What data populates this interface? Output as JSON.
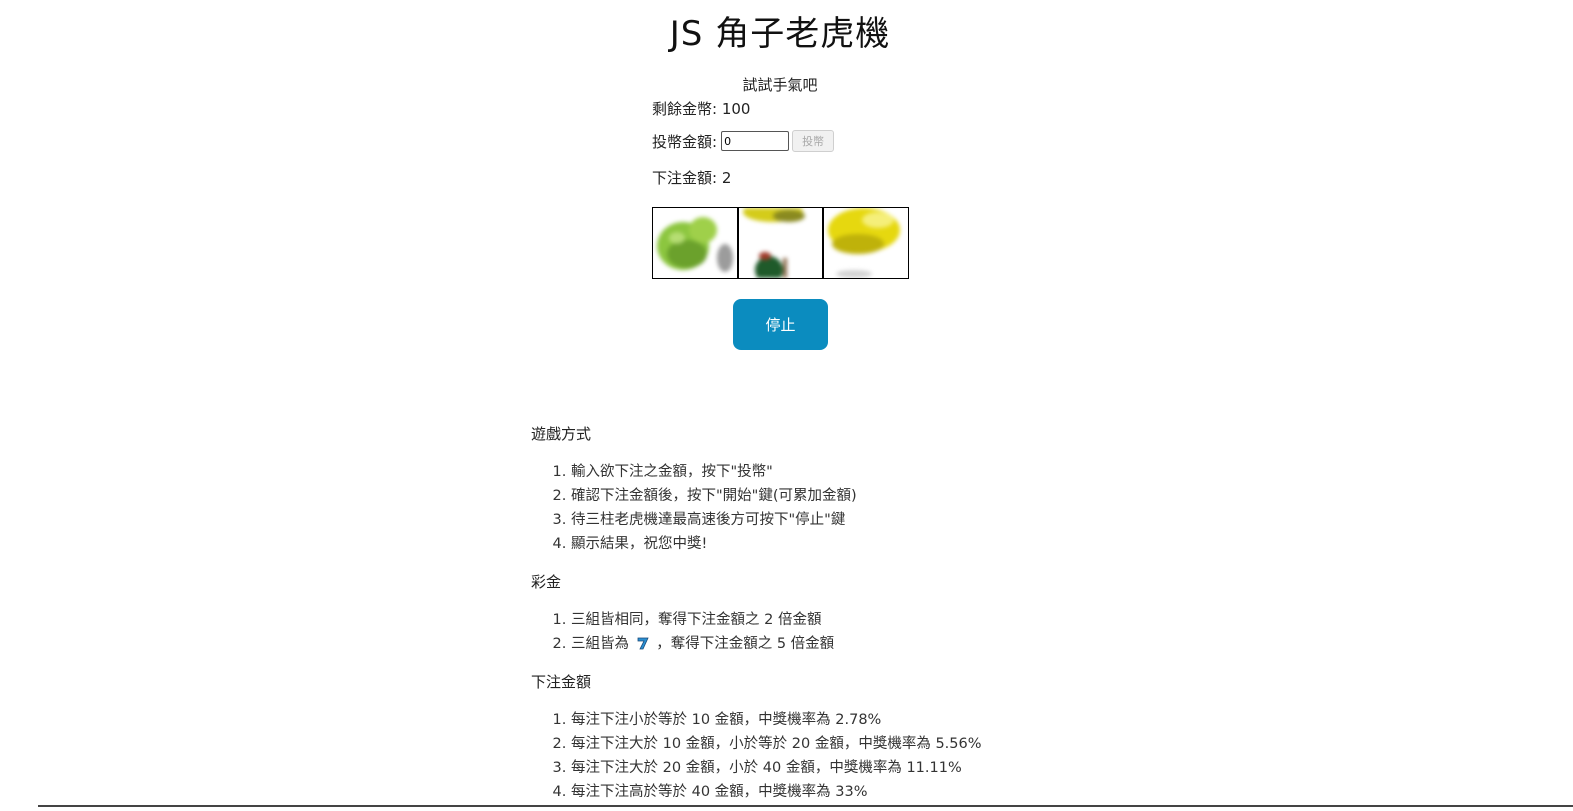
{
  "page": {
    "title": "JS 角子老虎機"
  },
  "game": {
    "subtitle": "試試手氣吧",
    "remaining_label": "剩餘金幣: 100",
    "insert_label": "投幣金額:",
    "insert_value": "0",
    "insert_button": "投幣",
    "bet_label": "下注金額: 2",
    "stop_button": "停止",
    "reels": [
      {
        "icon": "pear-icon",
        "color": "#8cc63f"
      },
      {
        "icon": "banana-cherry-icon",
        "color": "#d4cc1a"
      },
      {
        "icon": "banana-icon",
        "color": "#e6d80f"
      }
    ]
  },
  "rules": {
    "howto_title": "遊戲方式",
    "howto": [
      "輸入欲下注之金額，按下\"投幣\"",
      "確認下注金額後，按下\"開始\"鍵(可累加金額)",
      "待三柱老虎機達最高速後方可按下\"停止\"鍵",
      "顯示結果，祝您中獎!"
    ],
    "prize_title": "彩金",
    "prize_1": "三組皆相同，奪得下注金額之 2 倍金額",
    "prize_2_before": "三組皆為",
    "prize_2_after": "，奪得下注金額之 5 倍金額",
    "prize_2_icon": "seven-icon",
    "bet_title": "下注金額",
    "bets": [
      "每注下注小於等於 10 金額，中獎機率為 2.78%",
      "每注下注大於 10 金額，小於等於 20 金額，中獎機率為 5.56%",
      "每注下注大於 20 金額，小於 40 金額，中獎機率為 11.11%",
      "每注下注高於等於 40 金額，中獎機率為 33%"
    ]
  }
}
